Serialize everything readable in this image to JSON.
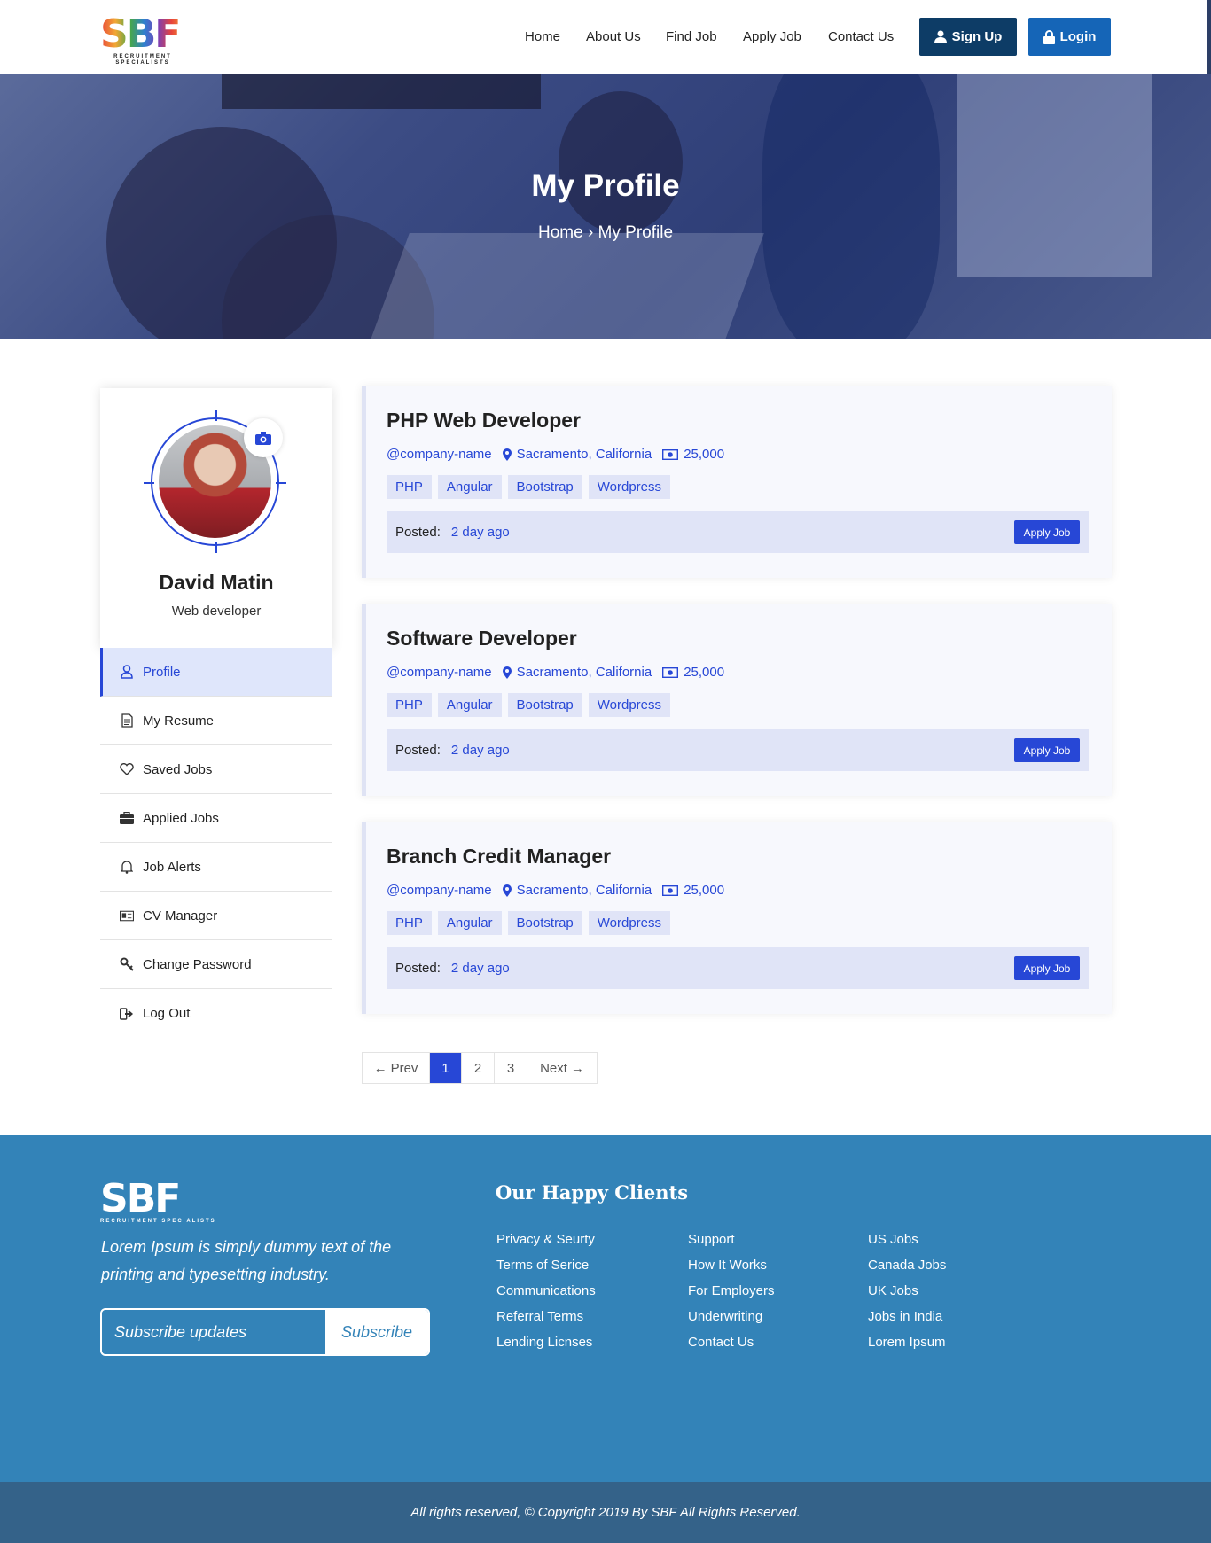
{
  "header": {
    "logo_text": "SBF",
    "logo_sub": "RECRUITMENT SPECIALISTS",
    "nav": [
      "Home",
      "About Us",
      "Find Job",
      "Apply Job",
      "Contact Us"
    ],
    "signup_label": "Sign Up",
    "login_label": "Login"
  },
  "hero": {
    "title": "My Profile",
    "breadcrumb_home": "Home",
    "breadcrumb_sep": "›",
    "breadcrumb_current": "My Profile"
  },
  "profile": {
    "name": "David Matin",
    "role": "Web developer"
  },
  "menu": [
    {
      "label": "Profile",
      "icon": "user-icon"
    },
    {
      "label": "My Resume",
      "icon": "document-icon"
    },
    {
      "label": "Saved Jobs",
      "icon": "heart-icon"
    },
    {
      "label": "Applied Jobs",
      "icon": "briefcase-icon"
    },
    {
      "label": "Job Alerts",
      "icon": "bell-icon"
    },
    {
      "label": "CV Manager",
      "icon": "id-card-icon"
    },
    {
      "label": "Change Password",
      "icon": "key-icon"
    },
    {
      "label": "Log Out",
      "icon": "logout-icon"
    }
  ],
  "jobs": [
    {
      "title": "PHP Web Developer",
      "company": "@company-name",
      "location": "Sacramento, California",
      "salary": "25,000",
      "tags": [
        "PHP",
        "Angular",
        "Bootstrap",
        "Wordpress"
      ],
      "posted_label": "Posted:",
      "posted_value": "2 day ago",
      "apply_label": "Apply Job"
    },
    {
      "title": "Software Developer",
      "company": "@company-name",
      "location": "Sacramento, California",
      "salary": "25,000",
      "tags": [
        "PHP",
        "Angular",
        "Bootstrap",
        "Wordpress"
      ],
      "posted_label": "Posted:",
      "posted_value": "2 day ago",
      "apply_label": "Apply Job"
    },
    {
      "title": "Branch Credit Manager",
      "company": "@company-name",
      "location": "Sacramento, California",
      "salary": "25,000",
      "tags": [
        "PHP",
        "Angular",
        "Bootstrap",
        "Wordpress"
      ],
      "posted_label": "Posted:",
      "posted_value": "2 day ago",
      "apply_label": "Apply Job"
    }
  ],
  "pagination": {
    "prev": "Prev",
    "pages": [
      "1",
      "2",
      "3"
    ],
    "current": "1",
    "next": "Next"
  },
  "footer": {
    "logo_text": "SBF",
    "logo_sub": "RECRUITMENT SPECIALISTS",
    "description": "Lorem Ipsum is simply dummy text of the printing and typesetting industry.",
    "subscribe_placeholder": "Subscribe updates",
    "subscribe_button": "Subscribe",
    "clients_heading": "Our Happy Clients",
    "col1": [
      "Privacy & Seurty",
      "Terms of Serice",
      "Communications",
      "Referral Terms",
      "Lending Licnses"
    ],
    "col2": [
      "Support",
      "How It Works",
      "For Employers",
      "Underwriting",
      "Contact Us"
    ],
    "col3": [
      "US Jobs",
      "Canada Jobs",
      "UK Jobs",
      "Jobs in India",
      "Lorem Ipsum"
    ],
    "copyright": "All rights reserved, © Copyright 2019 By  SBF All Rights Reserved."
  },
  "colors": {
    "accent": "#2747d6",
    "footer_bg": "#3383b8",
    "copyright_bg": "#346289",
    "signup_bg": "#0d3c66",
    "login_bg": "#1565b7"
  }
}
